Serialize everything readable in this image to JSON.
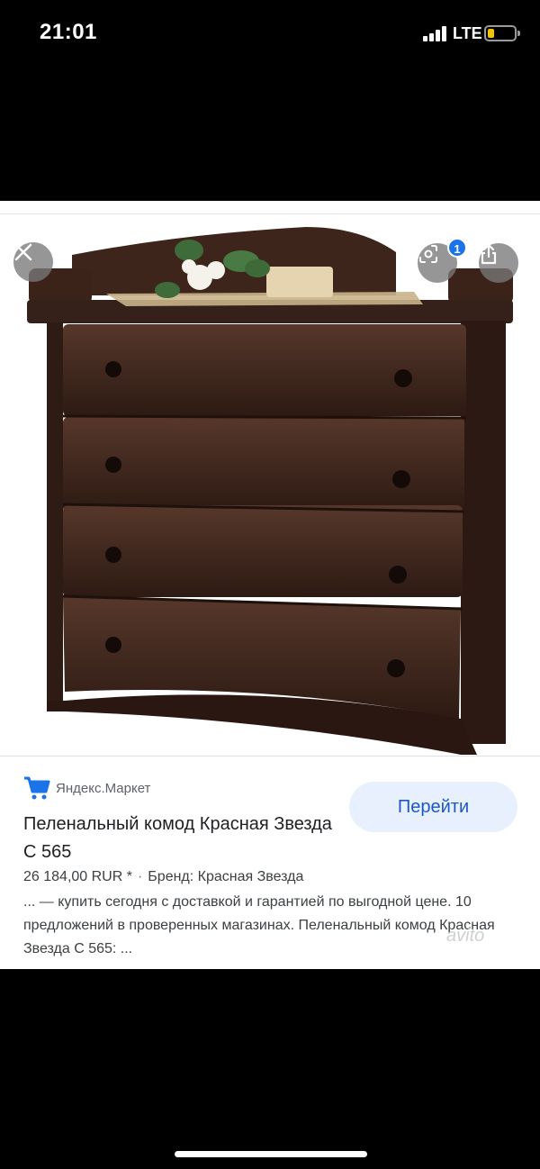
{
  "status_bar": {
    "time": "21:01",
    "network": "LTE",
    "battery_level": 0.25
  },
  "image_viewer": {
    "badge_count": "1",
    "icons": [
      "close-icon",
      "lens-icon",
      "share-icon"
    ],
    "watermark": "avito"
  },
  "result": {
    "source": "Яндекс.Маркет",
    "title": "Пеленальный комод Красная Звезда С 565",
    "price": "26 184,00 RUR *",
    "brand": "Бренд: Красная Звезда",
    "description": "... — купить сегодня с доставкой и гарантией по выгодной цене. 10 предложений в проверенных магазинах. Пеленальный комод Красная Звезда С 565: ...",
    "go_button": "Перейти"
  },
  "colors": {
    "accent": "#1a73e8",
    "button_bg": "#e8f0fe",
    "button_text": "#1a57c7"
  }
}
